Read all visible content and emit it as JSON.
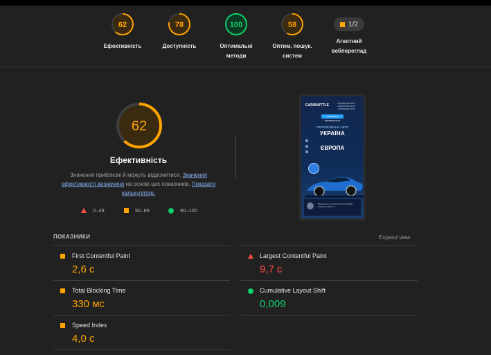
{
  "summary": {
    "gauges": [
      {
        "score": "62",
        "label_lines": [
          "Ефективність"
        ],
        "color": "#ffa400",
        "fraction": 0.62
      },
      {
        "score": "78",
        "label_lines": [
          "Доступність"
        ],
        "color": "#ffa400",
        "fraction": 0.78
      },
      {
        "score": "100",
        "label_lines": [
          "Оптимальні",
          "методи"
        ],
        "color": "#0cce6b",
        "fraction": 1.0
      },
      {
        "score": "58",
        "label_lines": [
          "Оптим. пошук.",
          "систем"
        ],
        "color": "#ffa400",
        "fraction": 0.58
      }
    ],
    "pwa": {
      "value": "1/2",
      "label_lines": [
        "Агентний",
        "вебпереглад"
      ]
    }
  },
  "performance": {
    "score": "62",
    "fraction": 0.62,
    "color": "#ffa400",
    "title": "Ефективність",
    "disclaimer": {
      "part1": "Значення приблизні й можуть відрізнятися. ",
      "link1": "Значення ефективності визначено",
      "part2": " на основі цих показників. ",
      "link2": "Показати калькулятор."
    },
    "legend": [
      {
        "range": "0–49",
        "shape": "triangle",
        "color": "#ff4e42"
      },
      {
        "range": "50–89",
        "shape": "square",
        "color": "#ffa400"
      },
      {
        "range": "90–100",
        "shape": "circle",
        "color": "#0cce6b"
      }
    ]
  },
  "screenshot": {
    "brand_prefix": "CAR",
    "brand_suffix": "SHUTTLE",
    "phones": [
      "+38(050)000-00-00",
      "+38(067)000-00-00",
      "+38(093)000-00-00"
    ],
    "button": "ЗАМОВИТИ ПЕРЕВЕЗЕННЯ",
    "line1": "ПЕРЕВЕЗЕННЯ АВТО",
    "line2": "УКРАЇНА",
    "line3": "ЄВРОПА",
    "footer": "Проведення доставлення автомобілів з України до Європи"
  },
  "metrics": {
    "header": "ПОКАЗНИКИ",
    "expand": "Expand view",
    "items": [
      {
        "name": "First Contentful Paint",
        "value": "2,6 с",
        "status": "average"
      },
      {
        "name": "Largest Contentful Paint",
        "value": "9,7 с",
        "status": "fail"
      },
      {
        "name": "Total Blocking Time",
        "value": "330 мс",
        "status": "average"
      },
      {
        "name": "Cumulative Layout Shift",
        "value": "0,009",
        "status": "pass"
      },
      {
        "name": "Speed Index",
        "value": "4,0 с",
        "status": "average"
      }
    ]
  }
}
